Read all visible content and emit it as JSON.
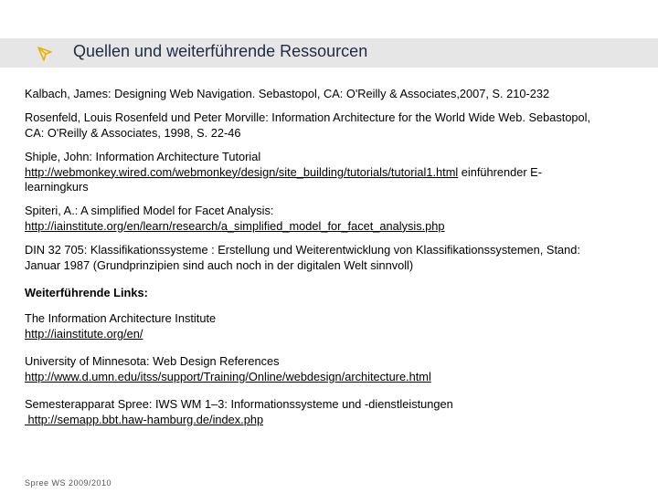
{
  "header": {
    "title": "Quellen und weiterführende Ressourcen",
    "icon": "arrow-check-icon",
    "icon_color": "#e8b300",
    "bar_color": "#e6e6e6"
  },
  "references": [
    {
      "text": "Kalbach, James: Designing Web Navigation. Sebastopol, CA: O'Reilly & Associates,2007, S. 210-232"
    },
    {
      "text": "Rosenfeld, Louis Rosenfeld und Peter Morville: Information Architecture for the World Wide Web. Sebastopol, CA: O'Reilly & Associates, 1998, S. 22-46"
    },
    {
      "text": "Shiple, John: Information Architecture Tutorial",
      "link": "http://webmonkey.wired.com/webmonkey/design/site_building/tutorials/tutorial1.html",
      "suffix": " einführender E-learningkurs"
    },
    {
      "text": "Spiteri, A.: A simplified Model for Facet Analysis:",
      "link": "http://iainstitute.org/en/learn/research/a_simplified_model_for_facet_analysis.php"
    },
    {
      "text": "DIN 32 705: Klassifikationssysteme : Erstellung und Weiterentwicklung von Klassifikationssystemen, Stand: Januar 1987 (Grundprinzipien sind auch noch in der digitalen Welt sinnvoll)"
    }
  ],
  "links_heading": "Weiterführende Links:",
  "links": [
    {
      "text": "The Information Architecture Institute",
      "link": "http://iainstitute.org/en/"
    },
    {
      "text": "University of Minnesota: Web Design References",
      "link": "http://www.d.umn.edu/itss/support/Training/Online/webdesign/architecture.html"
    },
    {
      "text": "Semesterapparat Spree: IWS WM 1–3: Informationssysteme und -dienstleistungen",
      "link": " http://semapp.bbt.haw-hamburg.de/index.php"
    }
  ],
  "footer": "Spree WS 2009/2010"
}
